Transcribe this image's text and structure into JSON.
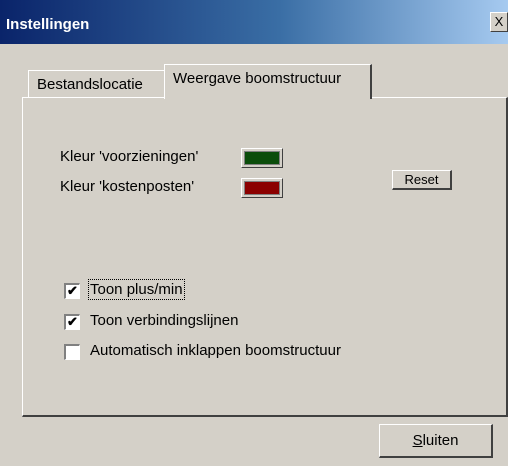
{
  "window": {
    "title": "Instellingen",
    "close_label": "X"
  },
  "tabs": [
    {
      "label": "Bestandslocatie",
      "active": false
    },
    {
      "label": "Weergave boomstructuur",
      "active": true
    }
  ],
  "colors": [
    {
      "label": "Kleur 'voorzieningen'",
      "color": "#0b4d0b"
    },
    {
      "label": "Kleur 'kostenposten'",
      "color": "#8b0000"
    }
  ],
  "reset_label": "Reset",
  "options": [
    {
      "label": "Toon plus/min",
      "checked": true
    },
    {
      "label": "Toon verbindingslijnen",
      "checked": true
    },
    {
      "label": "Automatisch inklappen boomstructuur",
      "checked": false
    }
  ],
  "close_button": {
    "label": "Sluiten"
  }
}
